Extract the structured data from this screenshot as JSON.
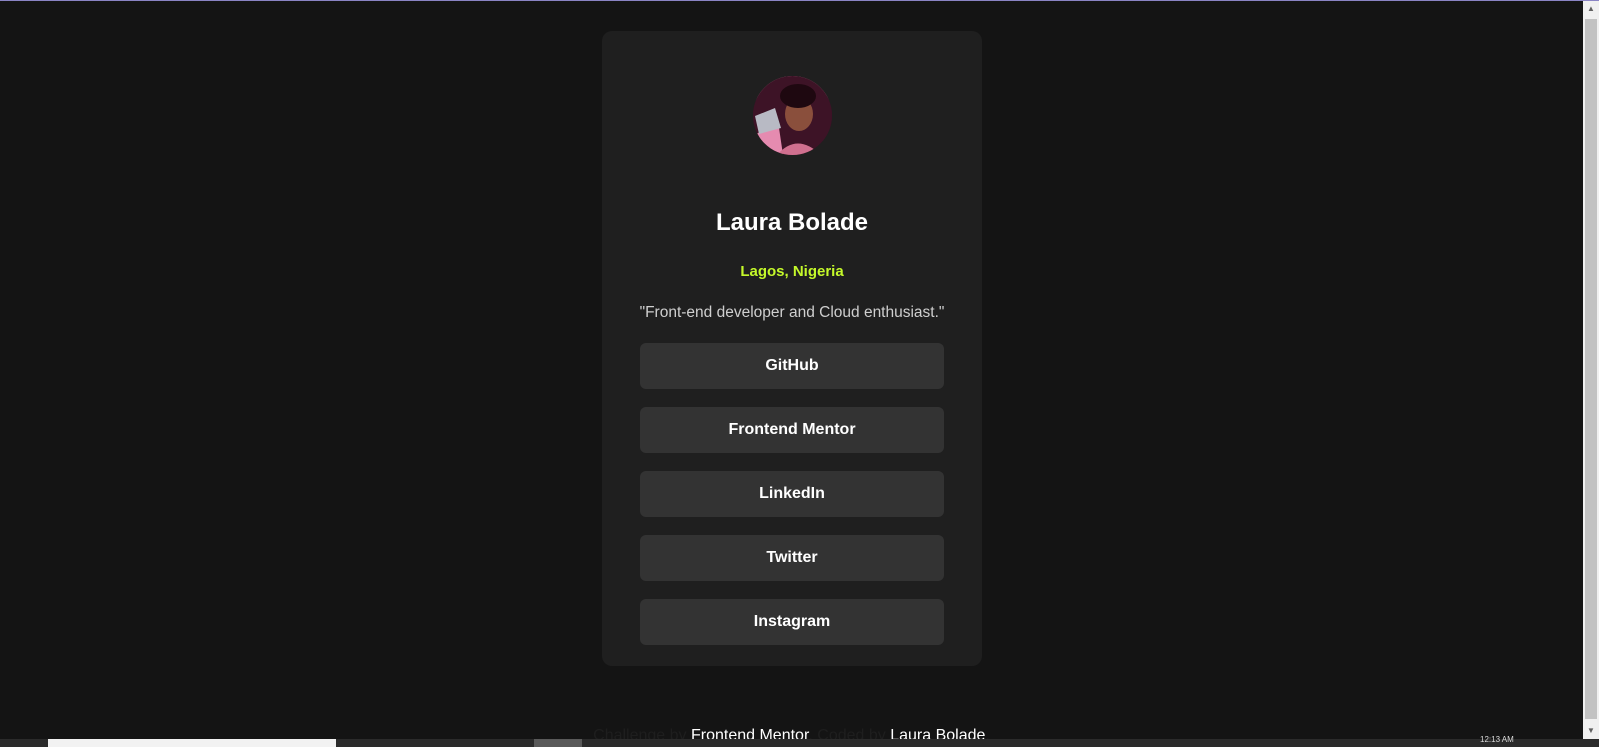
{
  "profile": {
    "name": "Laura Bolade",
    "location": "Lagos, Nigeria",
    "bio": "\"Front-end developer and Cloud enthusiast.\""
  },
  "links": [
    {
      "label": "GitHub"
    },
    {
      "label": "Frontend Mentor"
    },
    {
      "label": "LinkedIn"
    },
    {
      "label": "Twitter"
    },
    {
      "label": "Instagram"
    }
  ],
  "footer": {
    "challenge_prefix": "Challenge by ",
    "challenge_link": "Frontend Mentor",
    "coded_prefix": ". Coded by ",
    "coded_link": "Laura Bolade",
    "suffix": "."
  },
  "taskbar": {
    "clock": "12:13 AM"
  },
  "colors": {
    "background": "#141414",
    "card": "#1f1f1f",
    "button": "#333333",
    "accent": "#c4f82a",
    "text": "#ffffff"
  }
}
